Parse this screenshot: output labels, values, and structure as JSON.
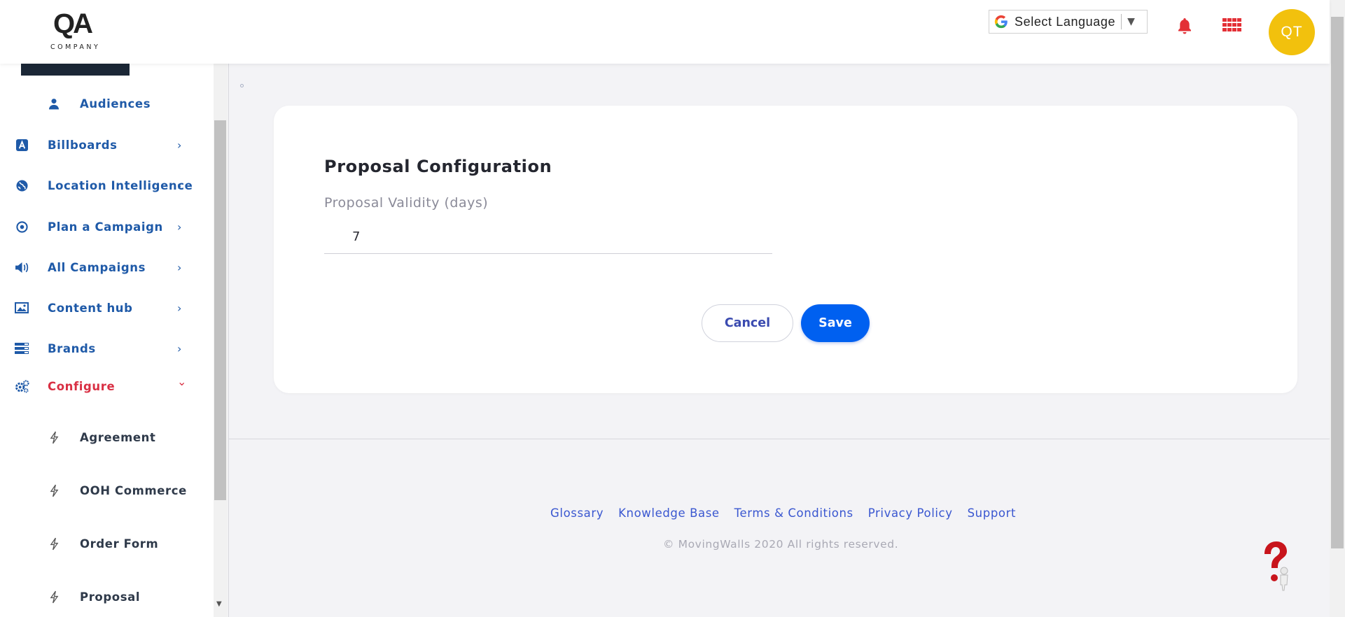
{
  "header": {
    "logo_mark": "QA",
    "logo_company": "COMPANY",
    "language_label": "Select Language",
    "language_arrow": "▼",
    "avatar_initials": "QT",
    "icons": [
      "google-icon",
      "bell-icon",
      "apps-grid-icon"
    ],
    "colors": {
      "avatar": "#f2c10d",
      "bell": "#e33036",
      "apps": "#e33036"
    }
  },
  "sidebar": {
    "items": [
      {
        "label": "Audiences",
        "icon": "user-icon",
        "sub": true
      },
      {
        "label": "Billboards",
        "icon": "billboard-icon",
        "chevron": "›"
      },
      {
        "label": "Location Intelligence",
        "icon": "globe-icon",
        "chevron": "›"
      },
      {
        "label": "Plan a Campaign",
        "icon": "target-icon",
        "chevron": "›"
      },
      {
        "label": "All Campaigns",
        "icon": "megaphone-icon",
        "chevron": "›"
      },
      {
        "label": "Content hub",
        "icon": "image-icon",
        "chevron": "›"
      },
      {
        "label": "Brands",
        "icon": "brands-icon",
        "chevron": "›"
      },
      {
        "label": "Configure",
        "icon": "gears-icon",
        "chevron": "⌄",
        "active": true
      }
    ],
    "sub_items": [
      {
        "label": "Agreement",
        "icon": "bolt-icon"
      },
      {
        "label": "OOH Commerce",
        "icon": "bolt-icon"
      },
      {
        "label": "Order Form",
        "icon": "bolt-icon"
      },
      {
        "label": "Proposal",
        "icon": "bolt-icon"
      }
    ],
    "colors": {
      "link": "#1f5aa8",
      "active": "#d93044"
    }
  },
  "main": {
    "title": "Proposal Configuration",
    "validity_label": "Proposal Validity (days)",
    "validity_value": "7",
    "cancel_label": "Cancel",
    "save_label": "Save",
    "colors": {
      "save_bg": "#0060f0"
    }
  },
  "footer": {
    "links": [
      "Glossary",
      "Knowledge Base",
      "Terms & Conditions",
      "Privacy Policy",
      "Support"
    ],
    "copyright": "© MovingWalls 2020 All rights reserved."
  }
}
